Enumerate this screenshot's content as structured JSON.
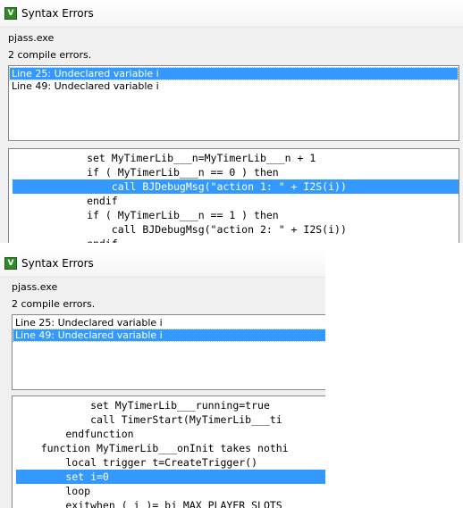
{
  "dialogs": [
    {
      "title": "Syntax Errors",
      "program": "pjass.exe",
      "error_count": "2 compile errors.",
      "errors": [
        "Line 25:  Undeclared variable i",
        "Line 49:  Undeclared variable i"
      ],
      "code_lines": [
        "            set MyTimerLib___n=MyTimerLib___n + 1",
        "            if ( MyTimerLib___n == 0 ) then",
        "                call BJDebugMsg(\"action 1: \" + I2S(i))",
        "            endif",
        "            if ( MyTimerLib___n == 1 ) then",
        "                call BJDebugMsg(\"action 2: \" + I2S(i))",
        "            endif"
      ]
    },
    {
      "title": "Syntax Errors",
      "program": "pjass.exe",
      "error_count": "2 compile errors.",
      "errors": [
        "Line 25:  Undeclared variable i",
        "Line 49:  Undeclared variable i"
      ],
      "code_lines": [
        "            set MyTimerLib___running=true",
        "            call TimerStart(MyTimerLib___ti",
        "        endfunction",
        "    function MyTimerLib___onInit takes nothi",
        "        local trigger t=CreateTrigger()",
        "        set i=0",
        "        loop",
        "        exitwhen ( i )= bj_MAX_PLAYER_SLOTS"
      ]
    }
  ],
  "app_icon_glyph": "V",
  "selection_color": "#3399ff"
}
